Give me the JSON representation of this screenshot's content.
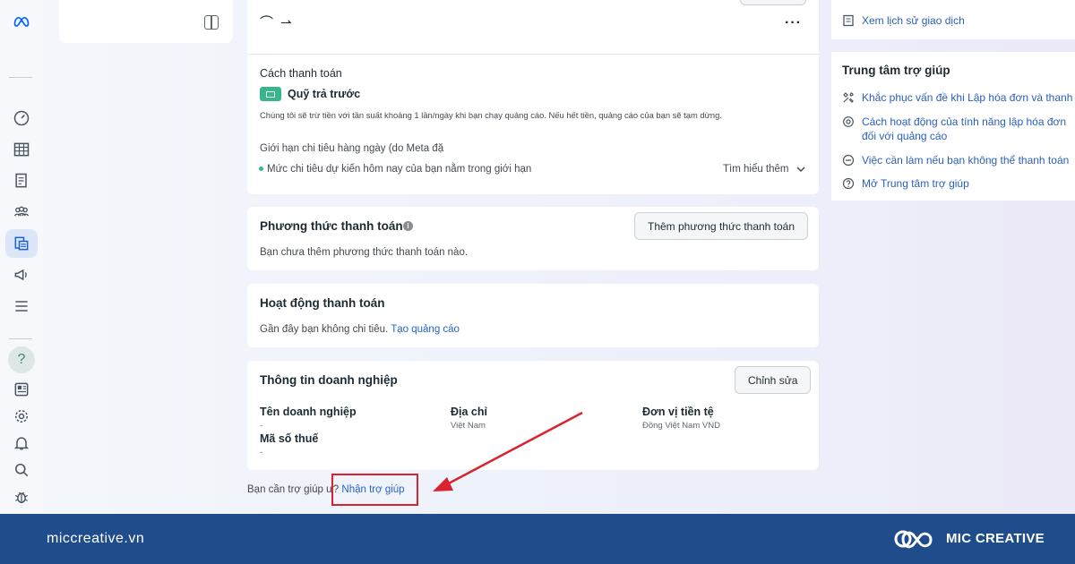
{
  "header": {
    "top_glyphs": "⌒ ⇀"
  },
  "payment_method_card": {
    "title": "Cách thanh toán",
    "method_name": "Quỹ trả trước",
    "description": "Chúng tôi sẽ trừ tiền với tần suất khoảng 1 lần/ngày khi bạn chạy quảng cáo. Nếu hết tiền, quảng cáo của bạn sẽ tạm dừng.",
    "daily_limit_label": "Giới hạn chi tiêu hàng ngày (do Meta đặ",
    "status_text": "Mức chi tiêu dự kiến hôm nay của bạn nằm trong giới hạn",
    "learn_more": "Tìm hiểu thêm"
  },
  "payment_methods": {
    "title": "Phương thức thanh toán",
    "add_button": "Thêm phương thức thanh toán",
    "empty_text": "Bạn chưa thêm phương thức thanh toán nào."
  },
  "payment_activity": {
    "title": "Hoạt động thanh toán",
    "empty_text": "Gần đây bạn không chi tiêu.",
    "create_ad_link": "Tạo quảng cáo"
  },
  "business_info": {
    "title": "Thông tin doanh nghiệp",
    "edit_button": "Chỉnh sửa",
    "fields": [
      {
        "label": "Tên doanh nghiệp",
        "value": "-"
      },
      {
        "label": "Địa chỉ",
        "value": "Việt Nam"
      },
      {
        "label": "Đơn vị tiền tệ",
        "value": "Đồng Việt Nam VND"
      },
      {
        "label": "Mã số thuế",
        "value": "-"
      }
    ]
  },
  "help_footer": {
    "prompt": "Bạn cần trợ giúp ư?",
    "link": "Nhận trợ giúp"
  },
  "right_panel": {
    "transaction_history_link": "Xem lịch sử giao dịch",
    "help_center_title": "Trung tâm trợ giúp",
    "help_links": [
      {
        "label": "Khắc phục vấn đề khi Lập hóa đơn và thanh toán",
        "icon": "tools-icon"
      },
      {
        "label": "Cách hoạt động của tính năng lập hóa đơn đối với quảng cáo",
        "icon": "settings-icon"
      },
      {
        "label": "Việc cần làm nếu bạn không thể thanh toán",
        "icon": "minus-circle-icon"
      },
      {
        "label": "Mở Trung tâm trợ giúp",
        "icon": "question-circle-icon"
      }
    ]
  },
  "banner": {
    "site": "miccreative.vn",
    "brand": "MIC CREATIVE"
  },
  "colors": {
    "link": "#2563c9",
    "highlight": "#d9232e",
    "banner": "#1f4d8c",
    "prepaid_badge": "#37b58d"
  }
}
